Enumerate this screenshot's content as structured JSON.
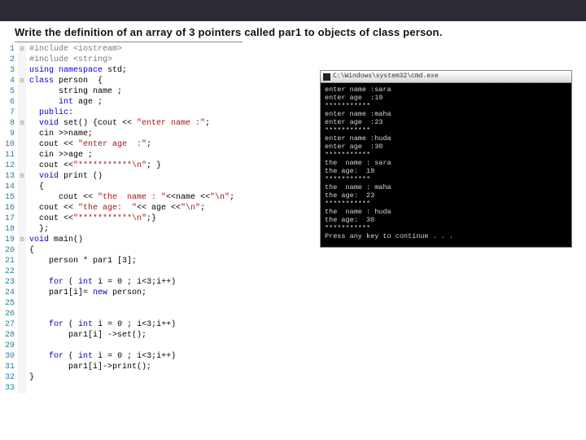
{
  "title": "Write the definition of an array of 3 pointers called par1  to objects of class person.",
  "code": {
    "lines": [
      {
        "n": "1",
        "fold": "⊟",
        "cls": "pp",
        "text": "#include <iostream>"
      },
      {
        "n": "2",
        "fold": "",
        "cls": "pp",
        "text": "#include <string>"
      },
      {
        "n": "3",
        "fold": "",
        "cls": "",
        "text": "using namespace std;",
        "kw": [
          "using",
          "namespace"
        ]
      },
      {
        "n": "4",
        "fold": "⊟",
        "cls": "",
        "text": "class person  {",
        "kw": [
          "class"
        ]
      },
      {
        "n": "5",
        "fold": "",
        "cls": "",
        "text": "      string name ;"
      },
      {
        "n": "6",
        "fold": "",
        "cls": "",
        "text": "      int age ;",
        "kw": [
          "int"
        ]
      },
      {
        "n": "7",
        "fold": "",
        "cls": "",
        "text": "  public:",
        "kw": [
          "public"
        ]
      },
      {
        "n": "8",
        "fold": "⊟",
        "cls": "",
        "text": "  void set() {cout << \"enter name :\";",
        "kw": [
          "void"
        ],
        "str": [
          "\"enter name :\""
        ]
      },
      {
        "n": "9",
        "fold": "",
        "cls": "",
        "text": "  cin >>name;"
      },
      {
        "n": "10",
        "fold": "",
        "cls": "",
        "text": "  cout << \"enter age  :\";",
        "str": [
          "\"enter age  :\""
        ]
      },
      {
        "n": "11",
        "fold": "",
        "cls": "",
        "text": "  cin >>age ; "
      },
      {
        "n": "12",
        "fold": "",
        "cls": "",
        "text": "  cout <<\"***********\\n\"; }",
        "str": [
          "\"***********\\n\""
        ]
      },
      {
        "n": "13",
        "fold": "⊟",
        "cls": "",
        "text": "  void print ()",
        "kw": [
          "void"
        ]
      },
      {
        "n": "14",
        "fold": "",
        "cls": "",
        "text": "  {"
      },
      {
        "n": "15",
        "fold": "",
        "cls": "",
        "text": "      cout << \"the  name : \"<<name <<\"\\n\";",
        "str": [
          "\"the  name : \"",
          "\"\\n\""
        ]
      },
      {
        "n": "16",
        "fold": "",
        "cls": "",
        "text": "  cout << \"the age:  \"<< age <<\"\\n\";",
        "str": [
          "\"the age:  \"",
          "\"\\n\""
        ]
      },
      {
        "n": "17",
        "fold": "",
        "cls": "",
        "text": "  cout <<\"***********\\n\";}",
        "str": [
          "\"***********\\n\""
        ]
      },
      {
        "n": "18",
        "fold": "",
        "cls": "",
        "text": "  };"
      },
      {
        "n": "19",
        "fold": "⊟",
        "cls": "",
        "text": "void main()",
        "kw": [
          "void"
        ]
      },
      {
        "n": "20",
        "fold": "",
        "cls": "",
        "text": "{"
      },
      {
        "n": "21",
        "fold": "",
        "cls": "",
        "text": "    person * par1 [3];"
      },
      {
        "n": "22",
        "fold": "",
        "cls": "",
        "text": ""
      },
      {
        "n": "23",
        "fold": "",
        "cls": "",
        "text": "    for ( int i = 0 ; i<3;i++)",
        "kw": [
          "for",
          "int"
        ]
      },
      {
        "n": "24",
        "fold": "",
        "cls": "",
        "text": "    par1[i]= new person;",
        "kw": [
          "new"
        ]
      },
      {
        "n": "25",
        "fold": "",
        "cls": "",
        "text": ""
      },
      {
        "n": "26",
        "fold": "",
        "cls": "",
        "text": ""
      },
      {
        "n": "27",
        "fold": "",
        "cls": "",
        "text": "    for ( int i = 0 ; i<3;i++)",
        "kw": [
          "for",
          "int"
        ]
      },
      {
        "n": "28",
        "fold": "",
        "cls": "",
        "text": "        par1[i] ->set();"
      },
      {
        "n": "29",
        "fold": "",
        "cls": "",
        "text": ""
      },
      {
        "n": "30",
        "fold": "",
        "cls": "",
        "text": "    for ( int i = 0 ; i<3;i++)",
        "kw": [
          "for",
          "int"
        ]
      },
      {
        "n": "31",
        "fold": "",
        "cls": "",
        "text": "        par1[i]->print();"
      },
      {
        "n": "32",
        "fold": "",
        "cls": "",
        "text": "}"
      },
      {
        "n": "33",
        "fold": "",
        "cls": "",
        "text": ""
      }
    ]
  },
  "console": {
    "title": "C:\\Windows\\system32\\cmd.exe",
    "lines": [
      "enter name :sara",
      "enter age  :19",
      "***********",
      "enter name :maha",
      "enter age  :23",
      "***********",
      "enter name :huda",
      "enter age  :30",
      "***********",
      "the  name : sara",
      "the age:  19",
      "***********",
      "the  name : maha",
      "the age:  23",
      "***********",
      "the  name : huda",
      "the age:  30",
      "***********",
      "Press any key to continue . . ."
    ]
  }
}
